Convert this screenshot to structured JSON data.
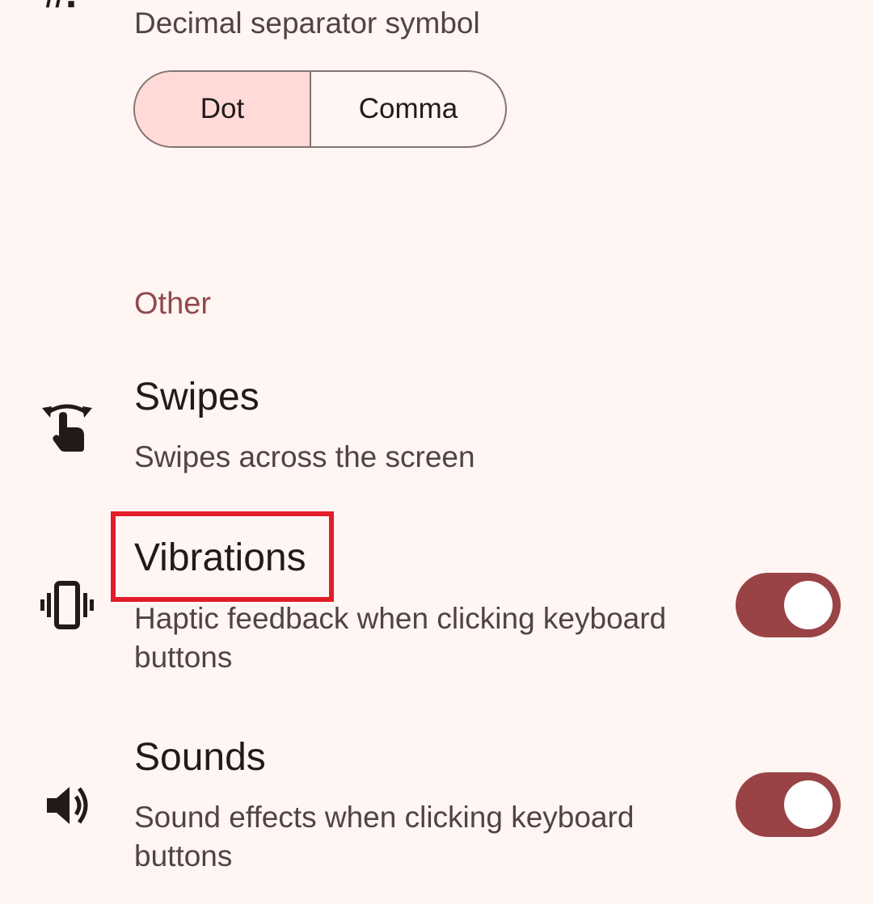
{
  "decimal_separator": {
    "icon_glyph": "#.",
    "icon": "decimal-separator-icon",
    "subtitle": "Decimal separator symbol",
    "options": [
      "Dot",
      "Comma"
    ],
    "selected": "Dot"
  },
  "other_section": {
    "header": "Other",
    "header_color": "#904a4c"
  },
  "swipes": {
    "icon": "swipe-gesture-icon",
    "title": "Swipes",
    "subtitle": "Swipes across the screen"
  },
  "vibrations": {
    "icon": "vibration-icon",
    "title": "Vibrations",
    "subtitle_line1": "Haptic feedback when clicking keyboard",
    "subtitle_line2": "buttons",
    "enabled": true
  },
  "sounds": {
    "icon": "volume-icon",
    "title": "Sounds",
    "subtitle_line1": "Sound effects when clicking keyboard",
    "subtitle_line2": "buttons",
    "enabled": true
  },
  "colors": {
    "background": "#fff5f3",
    "toggle_on": "#9a4346",
    "selected_segment": "#ffdad7",
    "highlight": "#e11d2a"
  }
}
